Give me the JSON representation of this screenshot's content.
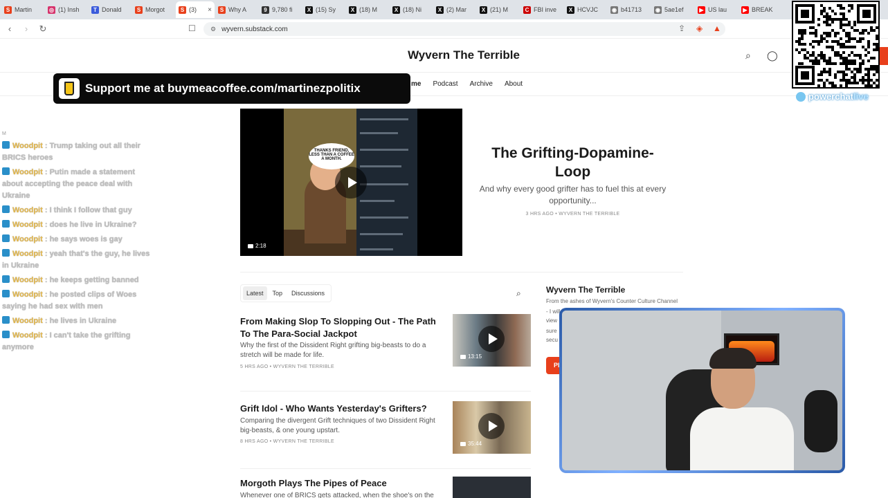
{
  "browser": {
    "tabs": [
      {
        "label": "Martin",
        "color": "#e8401c",
        "glyph": "S"
      },
      {
        "label": "(1) Insh",
        "color": "#d6336c",
        "glyph": "◎"
      },
      {
        "label": "Donald",
        "color": "#3b5bdb",
        "glyph": "T"
      },
      {
        "label": "Morgot",
        "color": "#e8401c",
        "glyph": "S"
      },
      {
        "label": "(3)",
        "color": "#e8401c",
        "glyph": "S",
        "active": true
      },
      {
        "label": "Why A",
        "color": "#e8401c",
        "glyph": "S"
      },
      {
        "label": "9,780 fi",
        "color": "#333333",
        "glyph": "9"
      },
      {
        "label": "(15) Sy",
        "color": "#111111",
        "glyph": "X"
      },
      {
        "label": "(18) M",
        "color": "#111111",
        "glyph": "X"
      },
      {
        "label": "(18) Ni",
        "color": "#111111",
        "glyph": "X"
      },
      {
        "label": "(2) Mar",
        "color": "#111111",
        "glyph": "X"
      },
      {
        "label": "(21) M",
        "color": "#111111",
        "glyph": "X"
      },
      {
        "label": "FBI inve",
        "color": "#cc0000",
        "glyph": "C"
      },
      {
        "label": "HCVJC",
        "color": "#111111",
        "glyph": "X"
      },
      {
        "label": "b41713",
        "color": "#777777",
        "glyph": "◉"
      },
      {
        "label": "5ae1ef",
        "color": "#777777",
        "glyph": "◉"
      },
      {
        "label": "US lau",
        "color": "#ff0000",
        "glyph": "▶"
      },
      {
        "label": "BREAK",
        "color": "#ff0000",
        "glyph": "▶"
      }
    ],
    "active_tab_close": "×",
    "url": "wyvern.substack.com"
  },
  "site": {
    "title": "Wyvern The Terrible",
    "nav": [
      "me",
      "Podcast",
      "Archive",
      "About"
    ]
  },
  "support_banner": "Support me at buymeacoffee.com/martinezpolitix",
  "featured": {
    "title": "The Grifting-Dopamine-Loop",
    "subtitle": "And why every good grifter has to fuel this at every opportunity...",
    "meta": "3 HRS AGO • WYVERN THE TERRIBLE",
    "duration": "2:18",
    "bubble_text": "THANKS FRIEND, LESS THAN A COFFEE A MONTH."
  },
  "feed_tabs": [
    "Latest",
    "Top",
    "Discussions"
  ],
  "posts": [
    {
      "title": "From Making Slop To Slopping Out - The Path To The Para-Social Jackpot",
      "subtitle": "Why the first of the Dissident Right grifting big-beasts to do a stretch will be made for life.",
      "meta": "5 HRS AGO • WYVERN THE TERRIBLE",
      "duration": "13:15"
    },
    {
      "title": "Grift Idol - Who Wants Yesterday's Grifters?",
      "subtitle": "Comparing the divergent Grift techniques of two Dissident Right big-beasts, & one young upstart.",
      "meta": "8 HRS AGO • WYVERN THE TERRIBLE",
      "duration": "35:44"
    },
    {
      "title": "Morgoth Plays The Pipes of Peace",
      "subtitle": "Whenever one of BRICS gets attacked, when the shoe's on the",
      "meta": "",
      "duration": ""
    }
  ],
  "sidebar": {
    "title": "Wyvern The Terrible",
    "description": "From the ashes of Wyvern's Counter Culture Channel",
    "clipped_lines": [
      "- I will",
      "view",
      "sure",
      "secu"
    ],
    "button_partial": "Pl"
  },
  "chat": {
    "header_mark": "M",
    "messages": [
      {
        "user": "Woodpit",
        "text": "Trump taking out all their BRICS heroes"
      },
      {
        "user": "Woodpit",
        "text": "Putin made a statement about accepting the peace deal with Ukraine"
      },
      {
        "user": "Woodpit",
        "text": "I think I follow that guy"
      },
      {
        "user": "Woodpit",
        "text": "does he live in Ukraine?"
      },
      {
        "user": "Woodpit",
        "text": "he says woes is gay"
      },
      {
        "user": "Woodpit",
        "text": "yeah that's the guy, he lives in Ukraine"
      },
      {
        "user": "Woodpit",
        "text": "he keeps getting banned"
      },
      {
        "user": "Woodpit",
        "text": "he posted clips of Woes saying he had sex with men"
      },
      {
        "user": "Woodpit",
        "text": "he lives in Ukraine"
      },
      {
        "user": "Woodpit",
        "text": "I can't take the grifting anymore"
      }
    ]
  },
  "overlay": {
    "powerchat": "powerchat",
    "powerchat_live": "live"
  },
  "colors": {
    "accent": "#e8401c",
    "chat_user": "#e5b84a",
    "chat_badge": "#2a8fc9"
  }
}
